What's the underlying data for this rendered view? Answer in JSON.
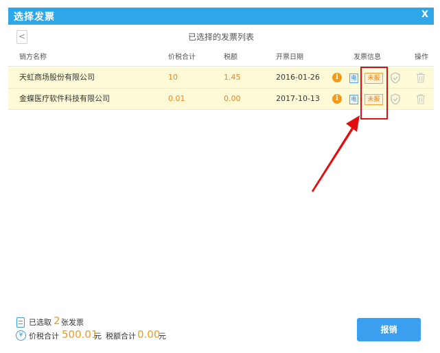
{
  "window": {
    "title": "选择发票",
    "close_label": "X"
  },
  "subheader": {
    "back_label": "<",
    "list_title": "已选择的发票列表"
  },
  "table": {
    "columns": [
      "销方名称",
      "价税合计",
      "税额",
      "开票日期",
      "发票信息",
      "操作"
    ],
    "rows": [
      {
        "seller": "天虹商场股份有限公司",
        "total": "10",
        "tax": "1.45",
        "date": "2016-01-26",
        "info_icon": "i",
        "e_label": "电",
        "status": "未报"
      },
      {
        "seller": "金蝶医疗软件科技有限公司",
        "total": "0.01",
        "tax": "0.00",
        "date": "2017-10-13",
        "info_icon": "i",
        "e_label": "电",
        "status": "未报"
      }
    ]
  },
  "annotation": {
    "highlight_color": "#e01010"
  },
  "footer": {
    "selected_prefix": "已选取",
    "selected_count": "2",
    "selected_suffix": "张发票",
    "total_label": "价税合计",
    "total_value": "500.01",
    "total_unit": "元",
    "tax_label": "税额合计",
    "tax_value": "0.00",
    "tax_unit": "元",
    "yen_symbol": "¥"
  },
  "actions": {
    "submit_label": "报销"
  },
  "colors": {
    "titlebar": "#2ea7e8",
    "row_bg": "#fdfbd7",
    "accent_orange": "#f39a1b",
    "button_blue": "#3b9ff0"
  }
}
